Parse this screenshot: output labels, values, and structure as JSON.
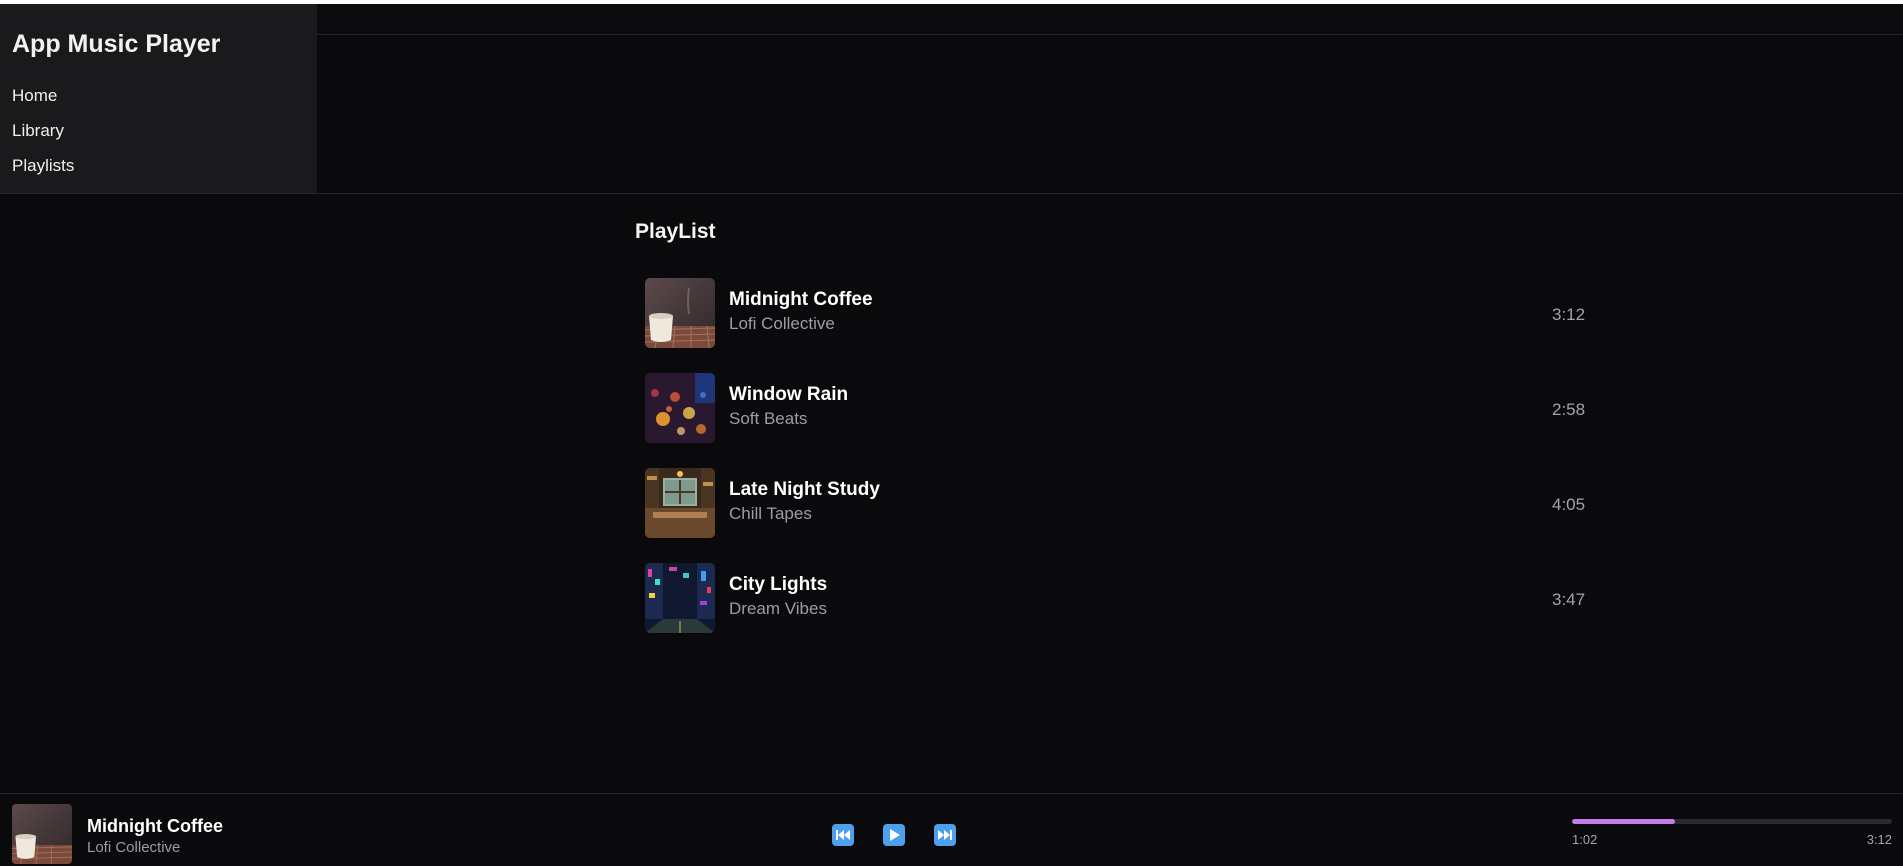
{
  "sidebar": {
    "app_title": "App Music Player",
    "nav": [
      {
        "label": "Home"
      },
      {
        "label": "Library"
      },
      {
        "label": "Playlists"
      }
    ]
  },
  "main": {
    "section_title": "PlayList",
    "tracks": [
      {
        "title": "Midnight Coffee",
        "artist": "Lofi Collective",
        "duration": "3:12",
        "art": "coffee-cup-artwork"
      },
      {
        "title": "Window Rain",
        "artist": "Soft Beats",
        "duration": "2:58",
        "art": "rain-bokeh-artwork"
      },
      {
        "title": "Late Night Study",
        "artist": "Chill Tapes",
        "duration": "4:05",
        "art": "study-room-artwork"
      },
      {
        "title": "City Lights",
        "artist": "Dream Vibes",
        "duration": "3:47",
        "art": "neon-city-artwork"
      }
    ]
  },
  "player": {
    "title": "Midnight Coffee",
    "artist": "Lofi Collective",
    "current_time": "1:02",
    "total_time": "3:12",
    "progress_fraction": 0.323,
    "controls": [
      "previous-icon",
      "play-icon",
      "next-icon"
    ]
  },
  "colors": {
    "background": "#0a0a0c",
    "sidebar": "#1a1a1c",
    "accent_button": "#4da0ee",
    "progress_fill": "#c27de6",
    "secondary_text": "#9d9da3"
  }
}
